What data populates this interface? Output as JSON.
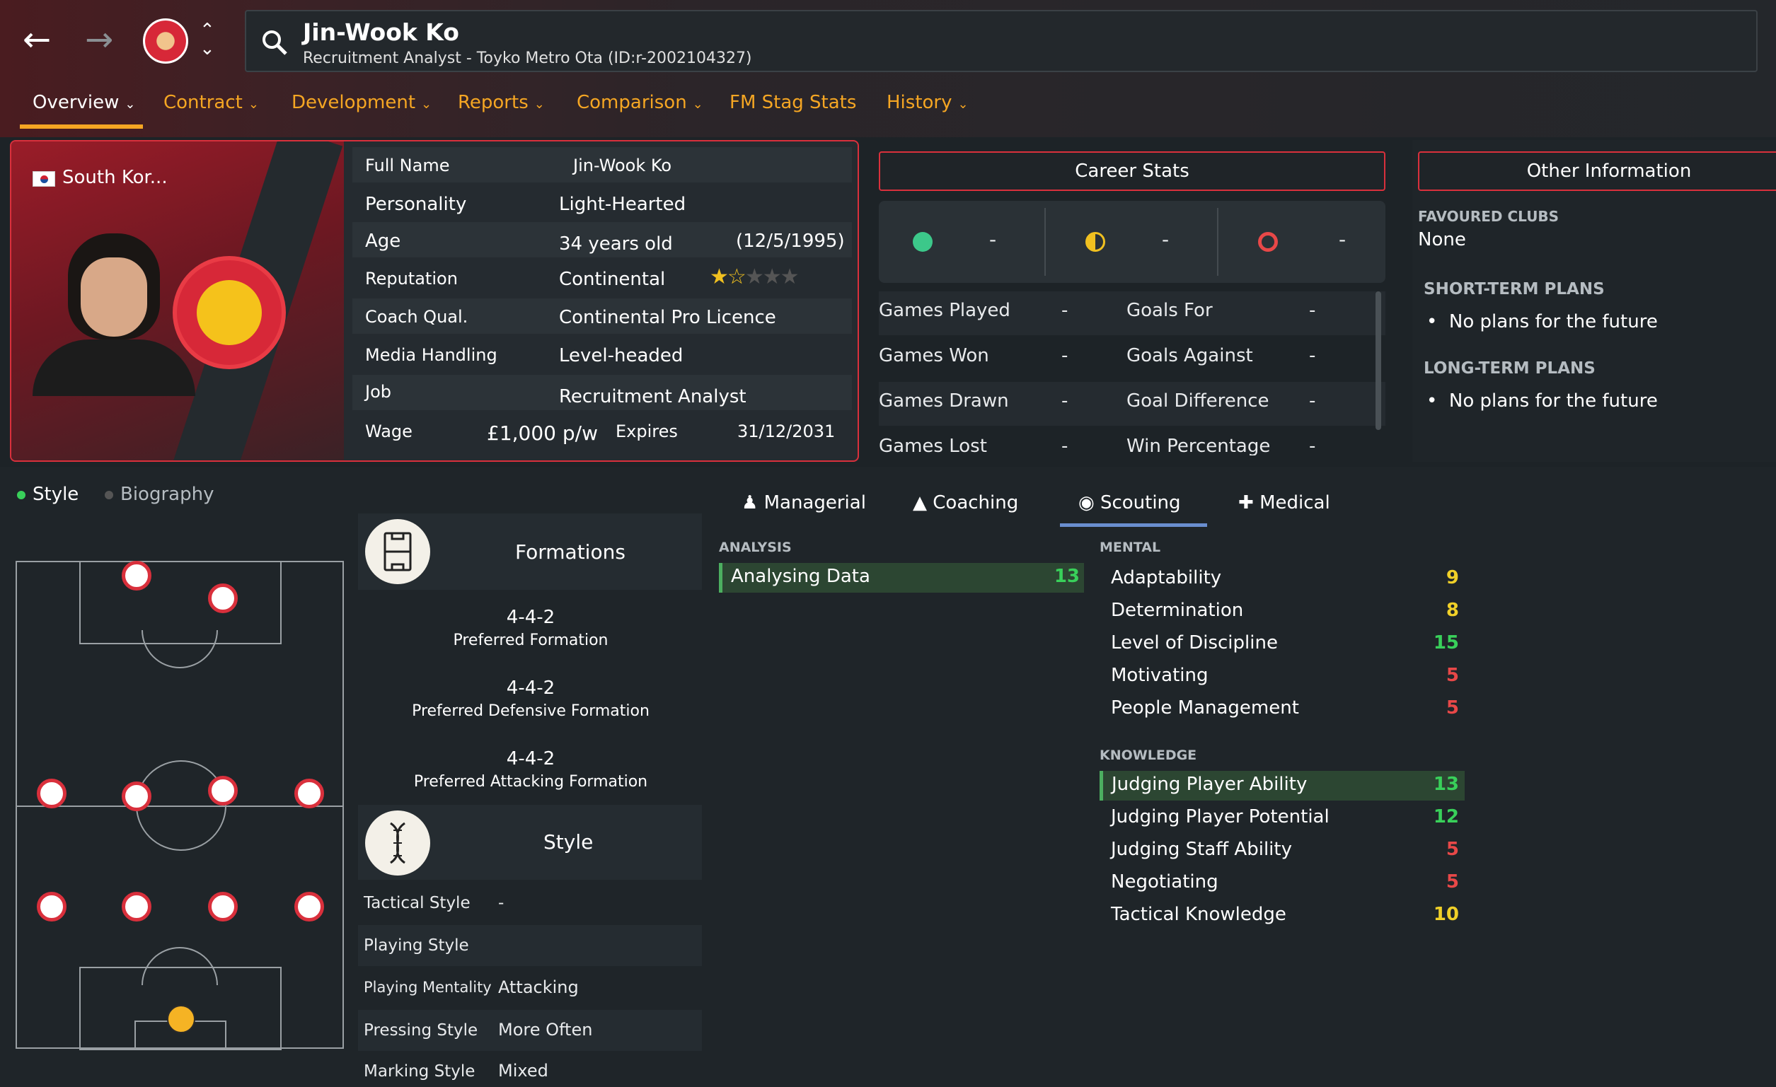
{
  "header": {
    "name": "Jin-Wook Ko",
    "subtitle": "Recruitment Analyst - Toyko Metro Ota (ID:r-2002104327)"
  },
  "tabs": [
    {
      "label": "Overview"
    },
    {
      "label": "Contract"
    },
    {
      "label": "Development"
    },
    {
      "label": "Reports"
    },
    {
      "label": "Comparison"
    },
    {
      "label": "FM Stag Stats"
    },
    {
      "label": "History"
    }
  ],
  "profile": {
    "nation": "South Kor...",
    "rows": [
      {
        "k": "Full Name",
        "v": "Jin-Wook Ko"
      },
      {
        "k": "Personality",
        "v": "Light-Hearted"
      },
      {
        "k": "Age",
        "v": "34 years old",
        "extra": "(12/5/1995)"
      },
      {
        "k": "Reputation",
        "v": "Continental",
        "stars": 1.5
      },
      {
        "k": "Coach Qual.",
        "v": "Continental Pro Licence"
      },
      {
        "k": "Media Handling",
        "v": "Level-headed"
      },
      {
        "k": "Job",
        "v": "Recruitment Analyst"
      },
      {
        "k": "Wage",
        "v": "£1,000 p/w",
        "k2": "Expires",
        "v2": "31/12/2031"
      }
    ]
  },
  "career": {
    "title": "Career Stats",
    "summary": [
      "-",
      "-",
      "-"
    ],
    "rows": [
      {
        "a": "Games Played",
        "av": "-",
        "b": "Goals For",
        "bv": "-"
      },
      {
        "a": "Games Won",
        "av": "-",
        "b": "Goals Against",
        "bv": "-"
      },
      {
        "a": "Games Drawn",
        "av": "-",
        "b": "Goal Difference",
        "bv": "-"
      },
      {
        "a": "Games Lost",
        "av": "-",
        "b": "Win Percentage",
        "bv": "-"
      }
    ]
  },
  "other": {
    "title": "Other Information",
    "fav_label": "FAVOURED CLUBS",
    "fav_value": "None",
    "short_label": "SHORT-TERM PLANS",
    "short_value": "No plans for the future",
    "long_label": "LONG-TERM PLANS",
    "long_value": "No plans for the future"
  },
  "left": {
    "tab_style": "Style",
    "tab_bio": "Biography",
    "formations_title": "Formations",
    "formations": [
      {
        "v": "4-4-2",
        "l": "Preferred Formation"
      },
      {
        "v": "4-4-2",
        "l": "Preferred Defensive Formation"
      },
      {
        "v": "4-4-2",
        "l": "Preferred Attacking Formation"
      }
    ],
    "style_title": "Style",
    "style_rows": [
      {
        "k": "Tactical Style",
        "v": "-"
      },
      {
        "k": "Playing Style",
        "v": ""
      },
      {
        "k": "Playing Mentality",
        "v": "Attacking"
      },
      {
        "k": "Pressing Style",
        "v": "More Often"
      },
      {
        "k": "Marking Style",
        "v": "Mixed"
      }
    ]
  },
  "right": {
    "tabs": [
      "Managerial",
      "Coaching",
      "Scouting",
      "Medical"
    ],
    "analysis_label": "ANALYSIS",
    "analysis": [
      {
        "n": "Analysing Data",
        "v": "13"
      }
    ],
    "mental_label": "MENTAL",
    "mental": [
      {
        "n": "Adaptability",
        "v": "9"
      },
      {
        "n": "Determination",
        "v": "8"
      },
      {
        "n": "Level of Discipline",
        "v": "15"
      },
      {
        "n": "Motivating",
        "v": "5"
      },
      {
        "n": "People Management",
        "v": "5"
      }
    ],
    "knowledge_label": "KNOWLEDGE",
    "knowledge": [
      {
        "n": "Judging Player Ability",
        "v": "13"
      },
      {
        "n": "Judging Player Potential",
        "v": "12"
      },
      {
        "n": "Judging Staff Ability",
        "v": "5"
      },
      {
        "n": "Negotiating",
        "v": "5"
      },
      {
        "n": "Tactical Knowledge",
        "v": "10"
      }
    ]
  },
  "colors": {
    "accent": "#f5a623",
    "border_red": "#d9303c",
    "good": "#39d05a",
    "mid": "#f0d028",
    "bad": "#e84848"
  }
}
